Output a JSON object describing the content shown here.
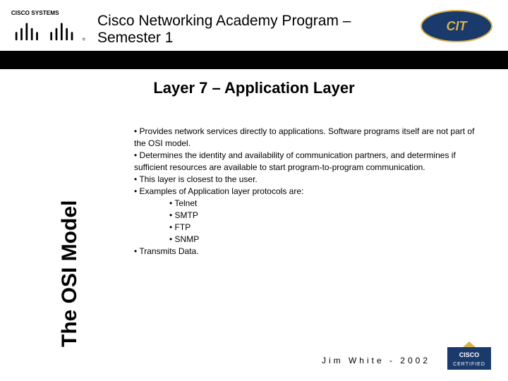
{
  "header": {
    "program_title": "Cisco Networking Academy Program – Semester 1",
    "logo_left_name": "CISCO SYSTEMS",
    "logo_right_name": "CIT"
  },
  "slide": {
    "title": "Layer 7 – Application Layer",
    "vertical_label": "The OSI Model",
    "bullets": [
      "Provides network services directly to applications. Software programs itself are not part of the OSI model.",
      "Determines the identity and availability of communication partners, and determines if sufficient resources are available to start program-to-program communication.",
      "This layer is closest to the user.",
      "Examples of Application layer protocols are:"
    ],
    "sub_bullets": [
      "Telnet",
      "SMTP",
      "FTP",
      "SNMP"
    ],
    "final_bullet": "Transmits Data."
  },
  "footer": {
    "credit": "Jim White - 2002",
    "cert_logo_name": "CISCO CERTIFIED"
  }
}
